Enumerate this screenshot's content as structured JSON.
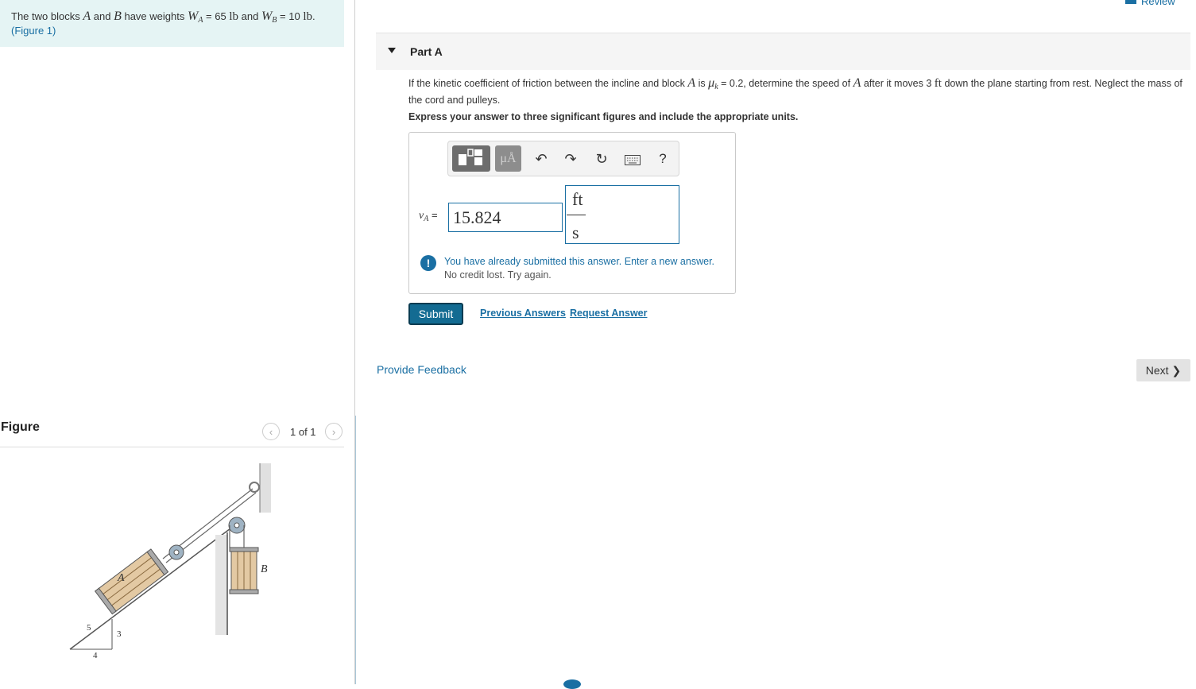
{
  "intro": {
    "text_start": "The two blocks",
    "block_a": "A",
    "and1": "and",
    "block_b": "B",
    "weights_text": "have weights",
    "wa_sym": "W",
    "wa_sub": "A",
    "wa_val": "= 65",
    "unit_lb": "lb",
    "and2": "and",
    "wb_sym": "W",
    "wb_sub": "B",
    "wb_val": "= 10",
    "unit_lb2": "lb",
    "period": ".",
    "figure_link": "(Figure 1)"
  },
  "header": {
    "review_label": "Review"
  },
  "part": {
    "title": "Part A"
  },
  "question": {
    "t1": "If the kinetic coefficient of friction between the incline and block",
    "block": "A",
    "t2": "is",
    "mu": "μ",
    "mu_sub": "k",
    "t3": "= 0.2, determine the speed of",
    "block2": "A",
    "t4": "after it moves 3",
    "unit_ft": "ft",
    "t5": "down the plane starting from rest. Neglect the mass of the cord and pulleys."
  },
  "instruction": "Express your answer to three significant figures and include the appropriate units.",
  "toolbar": {
    "units_label": "μÅ",
    "undo_icon": "undo-icon",
    "redo_icon": "redo-icon",
    "reset_icon": "reset-icon",
    "keyboard_icon": "keyboard-icon",
    "help_label": "?"
  },
  "answer": {
    "var_sym": "v",
    "var_sub": "A",
    "equals": "=",
    "value": "15.824",
    "unit_numerator": "ft",
    "unit_denominator": "s"
  },
  "alert": {
    "icon": "!",
    "line1": "You have already submitted this answer. Enter a new answer.",
    "line2": "No credit lost. Try again."
  },
  "actions": {
    "submit": "Submit",
    "previous_answers": "Previous Answers",
    "request_answer": "Request Answer"
  },
  "footer": {
    "feedback": "Provide Feedback",
    "next": "Next"
  },
  "figure": {
    "heading": "Figure",
    "counter": "1 of 1",
    "label_a": "A",
    "label_b": "B",
    "slope_5": "5",
    "slope_3": "3",
    "slope_4": "4"
  },
  "colors": {
    "accent": "#1a6fa3",
    "intro_bg": "#e5f4f4",
    "submit_bg": "#136b92"
  }
}
